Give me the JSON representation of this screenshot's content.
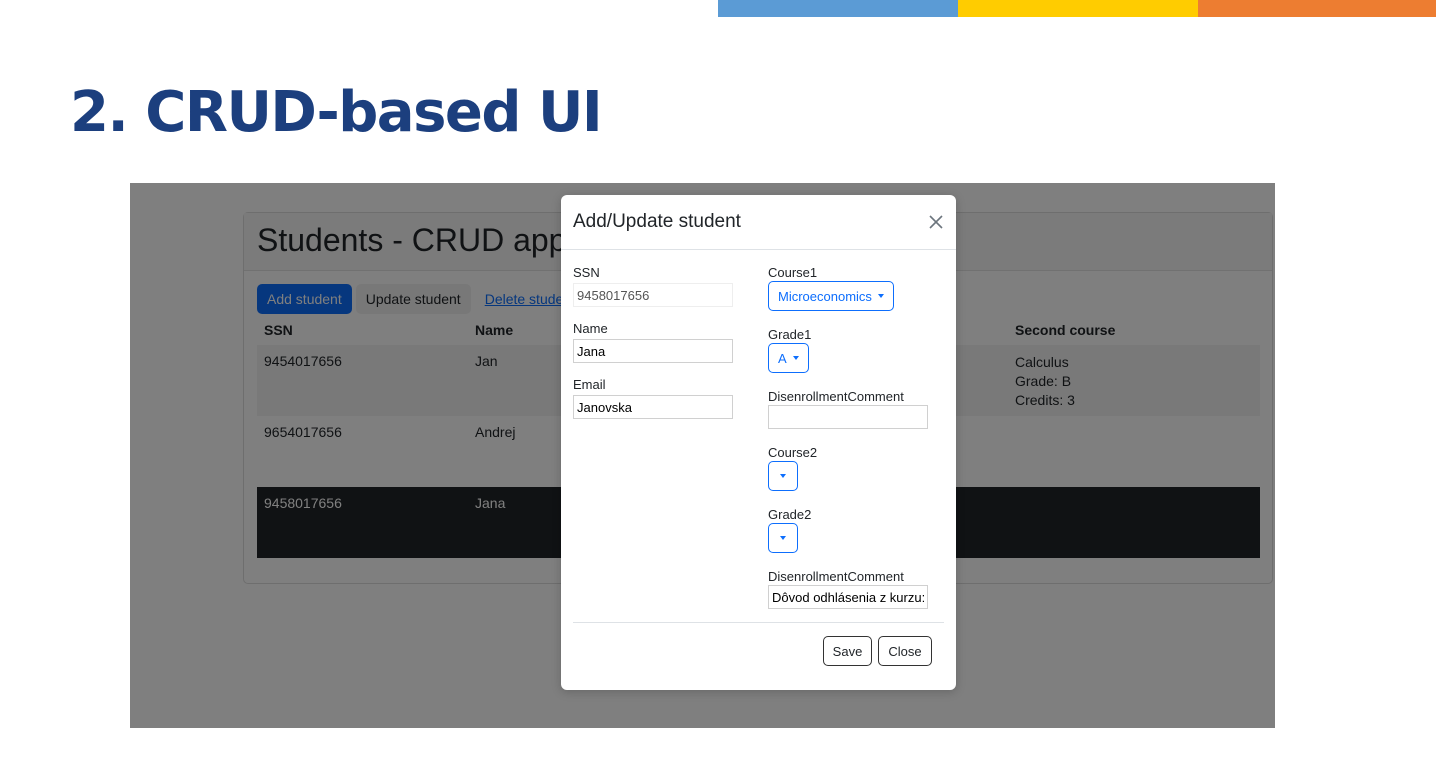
{
  "slide": {
    "title": "2. CRUD-based UI",
    "accent_colors": [
      "#5b9bd5",
      "#ffcc00",
      "#ed7d31"
    ],
    "title_color": "#1c3f7e"
  },
  "app": {
    "title": "Students - CRUD appr",
    "buttons": {
      "add": "Add student",
      "update": "Update student",
      "delete": "Delete student"
    },
    "table": {
      "columns": [
        "SSN",
        "Name",
        "Second course"
      ],
      "rows": [
        {
          "ssn": "9454017656",
          "name": "Jan",
          "second_course": [
            "Calculus",
            "Grade: B",
            "Credits: 3"
          ]
        },
        {
          "ssn": "9654017656",
          "name": "Andrej",
          "second_course": []
        },
        {
          "ssn": "9458017656",
          "name": "Jana",
          "second_course": [],
          "selected": true
        }
      ]
    }
  },
  "modal": {
    "title": "Add/Update student",
    "close_icon": "close-icon",
    "fields": {
      "ssn": {
        "label": "SSN",
        "value": "9458017656"
      },
      "name": {
        "label": "Name",
        "value": "Jana"
      },
      "email": {
        "label": "Email",
        "value": "Janovska"
      },
      "course1": {
        "label": "Course1",
        "value": "Microeconomics"
      },
      "grade1": {
        "label": "Grade1",
        "value": "A"
      },
      "disenroll1": {
        "label": "DisenrollmentComment",
        "value": ""
      },
      "course2": {
        "label": "Course2",
        "value": ""
      },
      "grade2": {
        "label": "Grade2",
        "value": ""
      },
      "disenroll2": {
        "label": "DisenrollmentComment",
        "value": "Dôvod odhlásenia z kurzu:"
      }
    },
    "footer": {
      "save": "Save",
      "close": "Close"
    }
  }
}
